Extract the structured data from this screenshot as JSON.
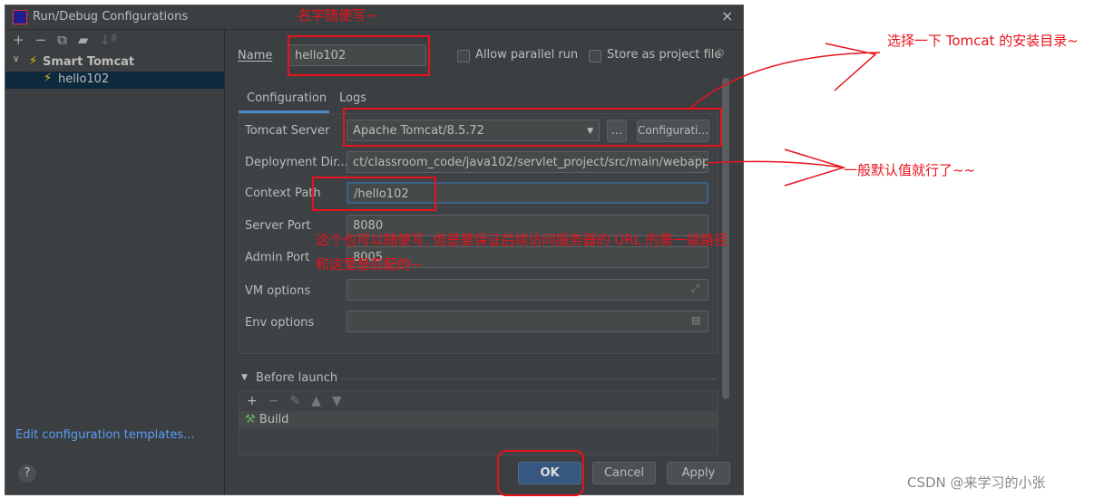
{
  "window": {
    "title": "Run/Debug Configurations",
    "close": "×"
  },
  "toolbar": {
    "add": "+",
    "remove": "−",
    "copy": "⧉",
    "folder": "▰",
    "sort": "↓ª"
  },
  "tree": {
    "group": "Smart Tomcat",
    "item": "hello102"
  },
  "left_footer": {
    "link": "Edit configuration templates...",
    "help": "?"
  },
  "form": {
    "name_label": "Name",
    "name_value": "hello102",
    "allow_parallel": "Allow parallel run",
    "store_project": "Store as project file",
    "tabs": [
      "Configuration",
      "Logs"
    ],
    "tomcat_server_label": "Tomcat Server",
    "tomcat_server_value": "Apache Tomcat/8.5.72",
    "dots": "...",
    "configure": "Configurati...",
    "deploy_label": "Deployment Dir...",
    "deploy_value": "ct/classroom_code/java102/servlet_project/src/main/webapp",
    "context_label": "Context Path",
    "context_value": "/hello102",
    "server_port_label": "Server Port",
    "server_port_value": "8080",
    "admin_port_label": "Admin Port",
    "admin_port_value": "8005",
    "vm_label": "VM options",
    "vm_value": "",
    "env_label": "Env options",
    "env_value": "",
    "before_launch": "Before launch",
    "build": "Build"
  },
  "buttons": {
    "ok": "OK",
    "cancel": "Cancel",
    "apply": "Apply"
  },
  "annotations": {
    "name": "名字随便写~",
    "tomcat": "选择一下 Tomcat 的安装目录~",
    "deploy": "一般默认值就行了~~",
    "context1": "这个也可以随便写, 但是要保证后续访问服务器的 URL 的第一级路径",
    "context2": "和这里是匹配的~"
  },
  "watermark": "CSDN @来学习的小张",
  "colors": {
    "accent": "#4a88c7",
    "annotation": "#e8121c",
    "ok": "#365880"
  }
}
